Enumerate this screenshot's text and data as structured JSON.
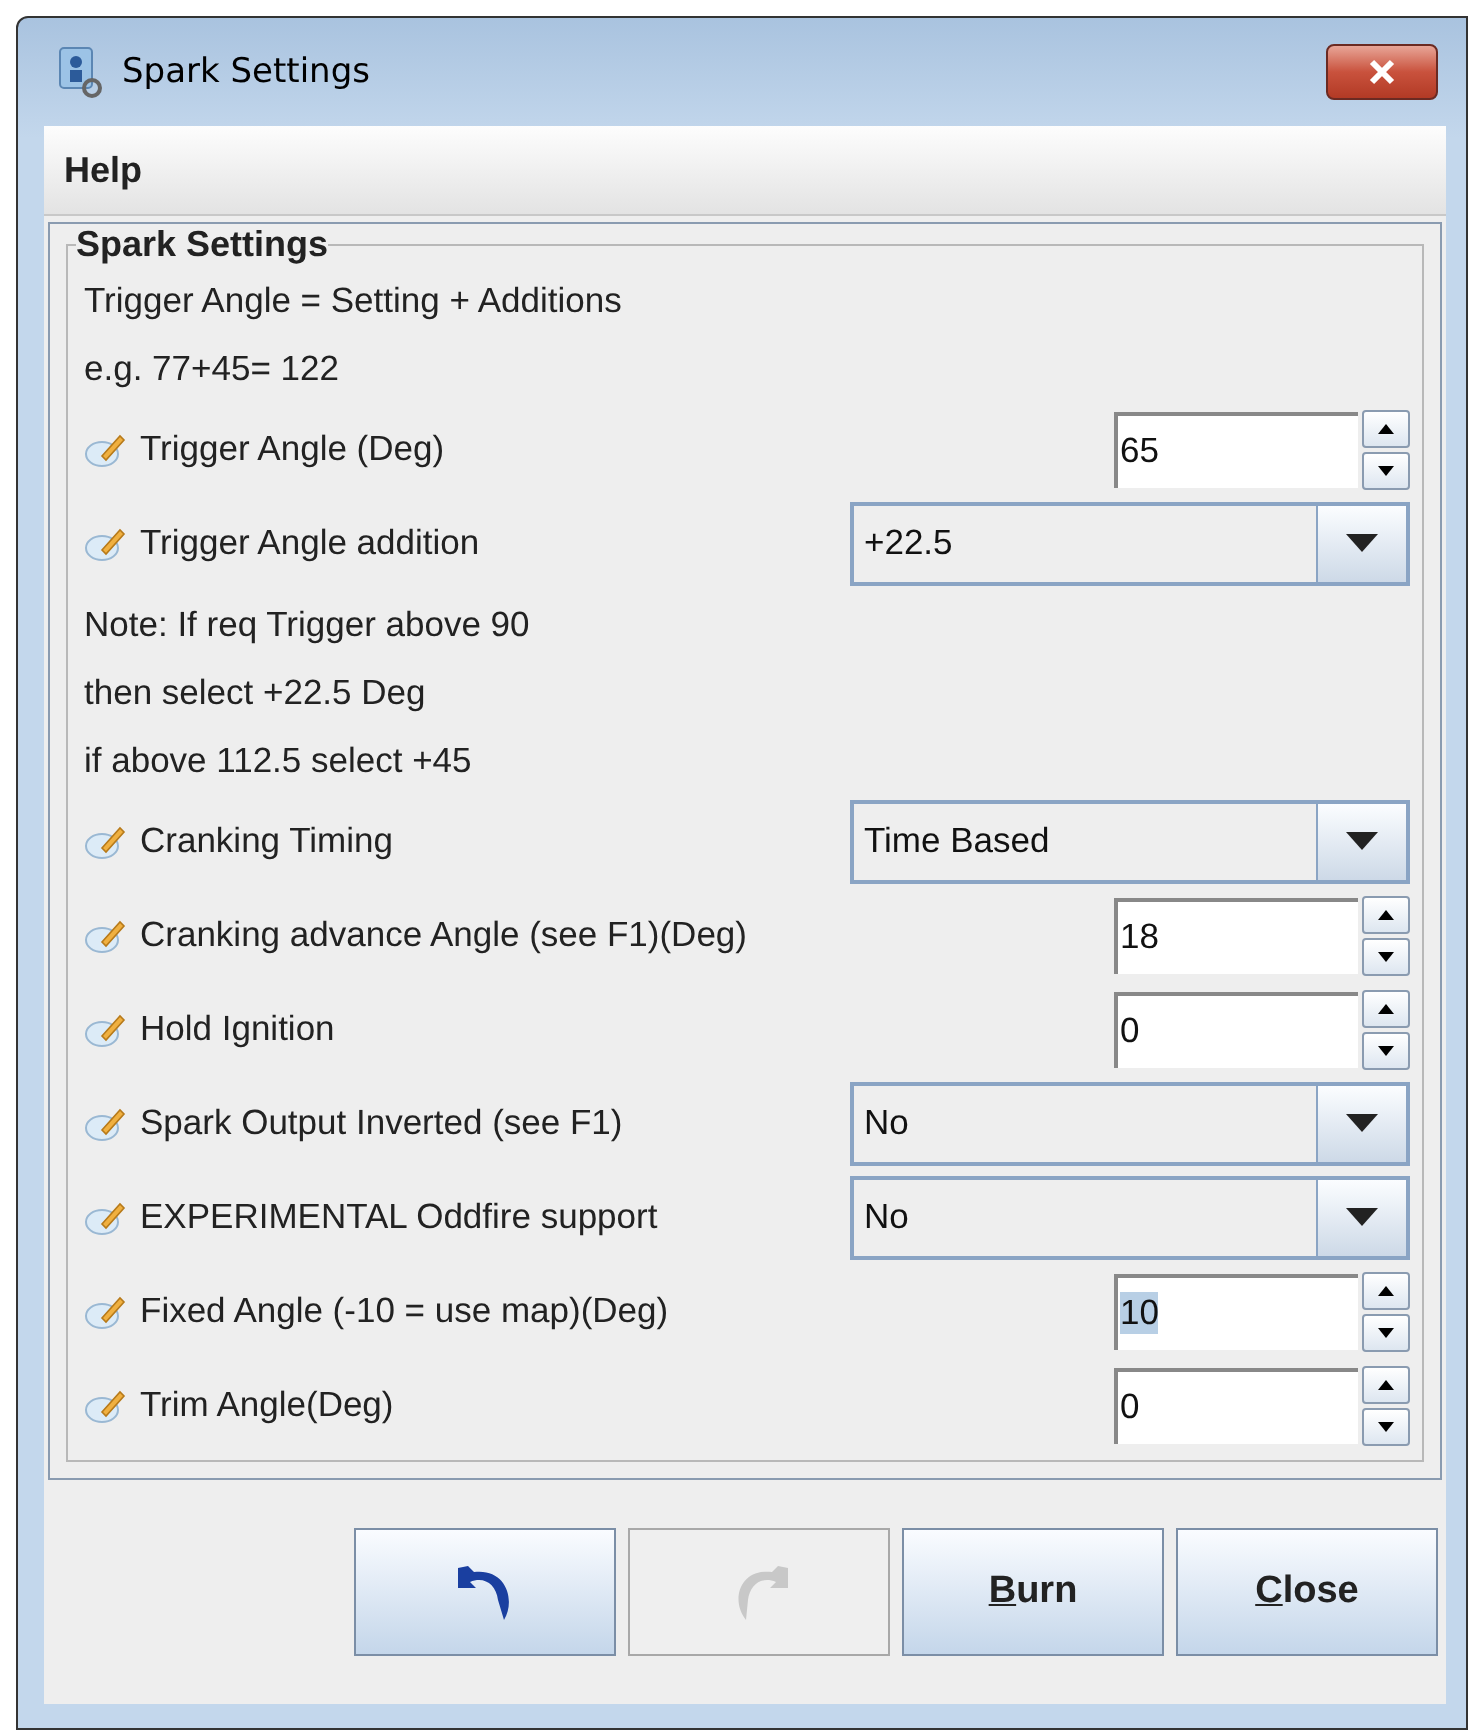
{
  "window": {
    "title": "Spark Settings"
  },
  "menu": [
    {
      "label": "Help"
    }
  ],
  "group": {
    "title": "Spark Settings"
  },
  "rows": [
    {
      "kind": "text",
      "label": "Trigger Angle = Setting + Additions"
    },
    {
      "kind": "text",
      "label": "e.g. 77+45= 122"
    },
    {
      "kind": "spinner",
      "label": "Trigger Angle (Deg)",
      "value": "65",
      "value_selected": false
    },
    {
      "kind": "combo",
      "label": "Trigger Angle addition",
      "value": "+22.5"
    },
    {
      "kind": "text",
      "label": "Note: If req Trigger above 90"
    },
    {
      "kind": "text",
      "label": "then select +22.5 Deg"
    },
    {
      "kind": "text",
      "label": "if above 112.5 select +45"
    },
    {
      "kind": "combo",
      "label": "Cranking Timing",
      "value": "Time Based"
    },
    {
      "kind": "spinner",
      "label": "Cranking advance Angle (see F1)(Deg)",
      "value": "18",
      "value_selected": false
    },
    {
      "kind": "spinner",
      "label": "Hold Ignition",
      "value": "0",
      "value_selected": false
    },
    {
      "kind": "combo",
      "label": "Spark Output Inverted (see F1)",
      "value": "No"
    },
    {
      "kind": "combo",
      "label": "EXPERIMENTAL Oddfire support",
      "value": "No"
    },
    {
      "kind": "spinner",
      "label": "Fixed Angle (-10 = use map)(Deg)",
      "value": "10",
      "value_selected": true
    },
    {
      "kind": "spinner",
      "label": "Trim Angle(Deg)",
      "value": "0",
      "value_selected": false
    }
  ],
  "buttons": [
    {
      "kind": "undo",
      "disabled": false
    },
    {
      "kind": "redo",
      "disabled": true
    },
    {
      "kind": "text",
      "label": "Burn",
      "disabled": false
    },
    {
      "kind": "text",
      "label": "Close",
      "disabled": false
    }
  ]
}
